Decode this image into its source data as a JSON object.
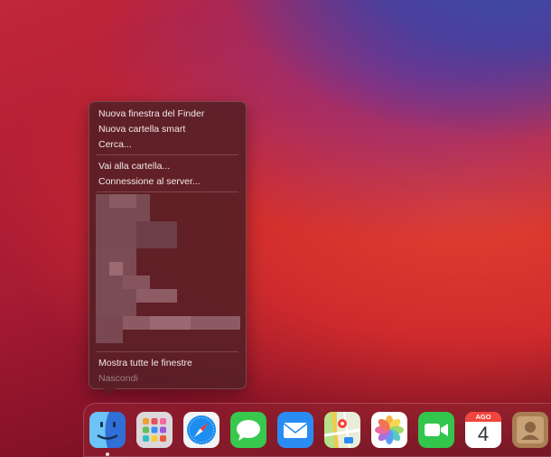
{
  "menu": {
    "items": [
      {
        "label": "Nuova finestra del Finder"
      },
      {
        "label": "Nuova cartella smart"
      },
      {
        "label": "Cerca..."
      },
      {
        "label": "Vai alla cartella..."
      },
      {
        "label": "Connessione al server..."
      }
    ],
    "show_all_windows": "Mostra tutte le finestre",
    "hide": "Nascondi"
  },
  "dock": {
    "apps": [
      {
        "name": "Finder",
        "icon": "finder-icon",
        "running": true
      },
      {
        "name": "Launchpad",
        "icon": "launchpad-icon"
      },
      {
        "name": "Safari",
        "icon": "safari-icon"
      },
      {
        "name": "Messaggi",
        "icon": "messages-icon"
      },
      {
        "name": "Mail",
        "icon": "mail-icon"
      },
      {
        "name": "Mappe",
        "icon": "maps-icon"
      },
      {
        "name": "Foto",
        "icon": "photos-icon"
      },
      {
        "name": "FaceTime",
        "icon": "facetime-icon"
      },
      {
        "name": "Calendario",
        "icon": "calendar-icon"
      },
      {
        "name": "Contatti",
        "icon": "contacts-icon"
      }
    ],
    "calendar": {
      "month": "AGO",
      "day": "4"
    }
  },
  "colors": {
    "menu_bg": "#58202699",
    "menu_text": "#f2e8e8",
    "disabled_text": "#9a7e80"
  }
}
